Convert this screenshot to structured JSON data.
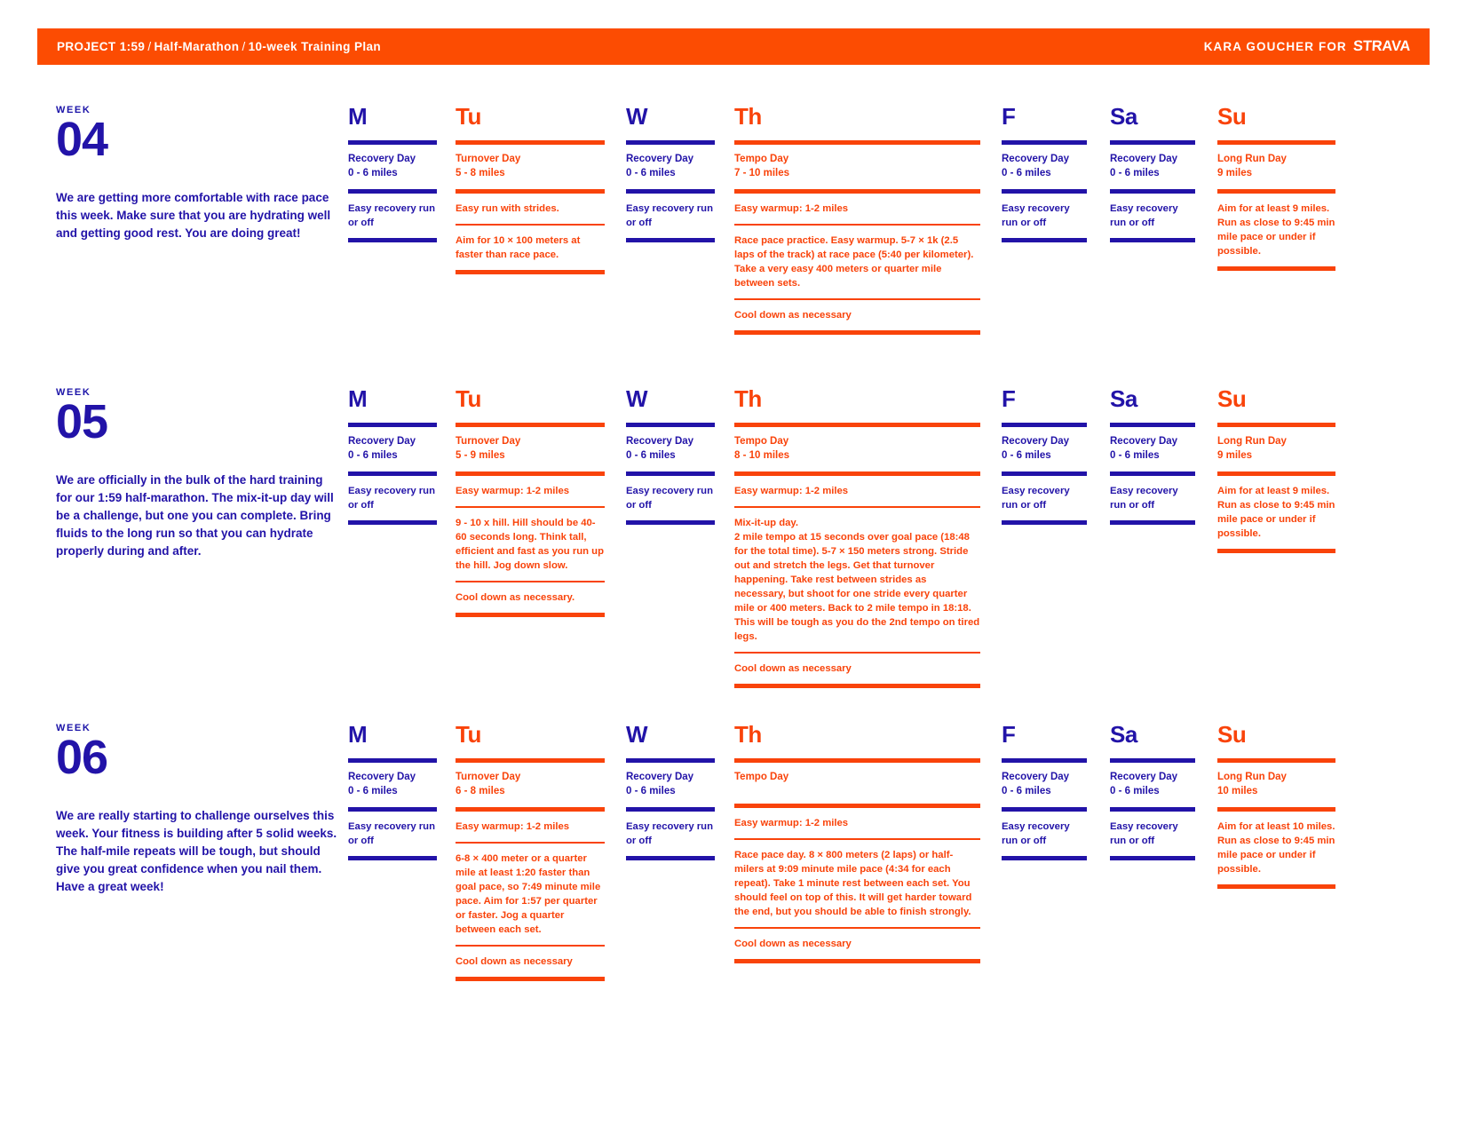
{
  "header": {
    "project": "PROJECT 1:59",
    "sep1": "/",
    "race": "Half-Marathon",
    "sep2": "/",
    "plan": "10-week Training Plan",
    "byline": "KARA GOUCHER FOR",
    "brand": "STRAVA"
  },
  "colors": {
    "orange": "#fc4c02",
    "blue": "#2213a8"
  },
  "kicker": "WEEK",
  "weeks": [
    {
      "number": "04",
      "description": "We are getting more comfortable with race pace this week. Make sure that you are hydrating well and getting good rest. You are doing great!",
      "days": [
        {
          "letter": "M",
          "accent": "blue",
          "title": "Recovery Day\n0 - 6 miles",
          "blocks": [
            {
              "lead": "",
              "body": "Easy recovery run or off"
            }
          ]
        },
        {
          "letter": "Tu",
          "accent": "orange",
          "title": "Turnover Day\n5 - 8 miles",
          "blocks": [
            {
              "lead": "Easy run with strides.",
              "body": ""
            },
            {
              "lead": "",
              "body": "Aim for 10 × 100 meters at faster than race pace."
            }
          ]
        },
        {
          "letter": "W",
          "accent": "blue",
          "title": "Recovery Day\n0 - 6 miles",
          "blocks": [
            {
              "lead": "",
              "body": "Easy recovery run or off"
            }
          ]
        },
        {
          "letter": "Th",
          "accent": "orange",
          "title": "Tempo Day\n7 - 10 miles",
          "blocks": [
            {
              "lead": "",
              "body": "Easy warmup: 1-2 miles"
            },
            {
              "lead": "Race pace practice.",
              "body": " Easy warmup. 5-7 × 1k (2.5 laps of the track) at race pace (5:40 per kilometer). Take a very easy 400 meters or quarter mile between sets."
            },
            {
              "lead": "",
              "body": "Cool down as necessary"
            }
          ]
        },
        {
          "letter": "F",
          "accent": "blue",
          "title": "Recovery Day\n0 - 6 miles",
          "blocks": [
            {
              "lead": "",
              "body": "Easy recovery run or off"
            }
          ]
        },
        {
          "letter": "Sa",
          "accent": "blue",
          "title": "Recovery Day\n0 - 6 miles",
          "blocks": [
            {
              "lead": "",
              "body": "Easy recovery run or off"
            }
          ]
        },
        {
          "letter": "Su",
          "accent": "orange",
          "title": "Long Run Day\n9 miles",
          "blocks": [
            {
              "lead": "",
              "body": "Aim for at least 9 miles. Run as close to 9:45 min mile pace or under if possible."
            }
          ]
        }
      ]
    },
    {
      "number": "05",
      "description": "We are officially in the bulk of the hard training for our 1:59 half-marathon. The mix-it-up day will be a challenge, but one you can complete. Bring fluids to the long run so that you can hydrate properly during and after.",
      "days": [
        {
          "letter": "M",
          "accent": "blue",
          "title": "Recovery Day\n0 - 6 miles",
          "blocks": [
            {
              "lead": "",
              "body": "Easy recovery run or off"
            }
          ]
        },
        {
          "letter": "Tu",
          "accent": "orange",
          "title": "Turnover Day\n5 - 9 miles",
          "blocks": [
            {
              "lead": "",
              "body": "Easy warmup: 1-2 miles"
            },
            {
              "lead": "9 - 10 x hill.",
              "body": " Hill should be 40-60 seconds long. Think tall, efficient and fast as you run up the hill. Jog down slow."
            },
            {
              "lead": "",
              "body": "Cool down as necessary."
            }
          ]
        },
        {
          "letter": "W",
          "accent": "blue",
          "title": "Recovery Day\n0 - 6 miles",
          "blocks": [
            {
              "lead": "",
              "body": "Easy recovery run or off"
            }
          ]
        },
        {
          "letter": "Th",
          "accent": "orange",
          "title": "Tempo Day\n8 - 10 miles",
          "blocks": [
            {
              "lead": "",
              "body": "Easy warmup: 1-2 miles"
            },
            {
              "lead": "Mix-it-up day.",
              "body": "\n2 mile tempo at 15 seconds over goal pace (18:48 for the total time). 5-7 × 150 meters strong. Stride out and stretch the legs. Get that turnover happening. Take rest between strides as necessary, but shoot for one stride every quarter mile or 400 meters. Back to 2 mile tempo in 18:18. This will be tough as you do the 2nd tempo on tired legs."
            },
            {
              "lead": "",
              "body": "Cool down as necessary"
            }
          ]
        },
        {
          "letter": "F",
          "accent": "blue",
          "title": "Recovery Day\n0 - 6 miles",
          "blocks": [
            {
              "lead": "",
              "body": "Easy recovery run or off"
            }
          ]
        },
        {
          "letter": "Sa",
          "accent": "blue",
          "title": "Recovery Day\n0 - 6 miles",
          "blocks": [
            {
              "lead": "",
              "body": "Easy recovery run or off"
            }
          ]
        },
        {
          "letter": "Su",
          "accent": "orange",
          "title": "Long Run Day\n9 miles",
          "blocks": [
            {
              "lead": "",
              "body": "Aim for at least 9 miles. Run as close to 9:45 min mile pace or under if possible."
            }
          ]
        }
      ]
    },
    {
      "number": "06",
      "description": "We are really starting to challenge ourselves this week. Your fitness is building after 5 solid weeks. The half-mile repeats will be tough, but should give you great confidence when you nail them. Have a great week!",
      "days": [
        {
          "letter": "M",
          "accent": "blue",
          "title": "Recovery Day\n0 - 6 miles",
          "blocks": [
            {
              "lead": "",
              "body": "Easy recovery run or off"
            }
          ]
        },
        {
          "letter": "Tu",
          "accent": "orange",
          "title": "Turnover Day\n6 - 8 miles",
          "blocks": [
            {
              "lead": "",
              "body": "Easy warmup: 1-2 miles"
            },
            {
              "lead": "6-8 × 400 meter",
              "body": " or a quarter mile at least 1:20 faster than goal pace, so 7:49 minute mile pace. Aim for 1:57 per quarter or faster. Jog a quarter between each set."
            },
            {
              "lead": "",
              "body": "Cool down as necessary"
            }
          ]
        },
        {
          "letter": "W",
          "accent": "blue",
          "title": "Recovery Day\n0 - 6 miles",
          "blocks": [
            {
              "lead": "",
              "body": "Easy recovery run or off"
            }
          ]
        },
        {
          "letter": "Th",
          "accent": "orange",
          "title": "Tempo Day",
          "blocks": [
            {
              "lead": "",
              "body": "Easy warmup: 1-2 miles"
            },
            {
              "lead": "Race pace day.",
              "body": " 8 × 800 meters (2 laps) or half-milers at 9:09 minute mile pace (4:34 for each repeat). Take 1 minute rest between each set. You should feel on top of this. It will get harder toward the end, but you should be able to finish strongly."
            },
            {
              "lead": "",
              "body": "Cool down as necessary"
            }
          ]
        },
        {
          "letter": "F",
          "accent": "blue",
          "title": "Recovery Day\n0 - 6 miles",
          "blocks": [
            {
              "lead": "",
              "body": "Easy recovery run or off"
            }
          ]
        },
        {
          "letter": "Sa",
          "accent": "blue",
          "title": "Recovery Day\n0 - 6 miles",
          "blocks": [
            {
              "lead": "",
              "body": "Easy recovery run or off"
            }
          ]
        },
        {
          "letter": "Su",
          "accent": "orange",
          "title": "Long Run Day\n10 miles",
          "blocks": [
            {
              "lead": "",
              "body": "Aim for at least 10 miles. Run as close to 9:45 min mile pace or under if possible."
            }
          ]
        }
      ]
    }
  ]
}
